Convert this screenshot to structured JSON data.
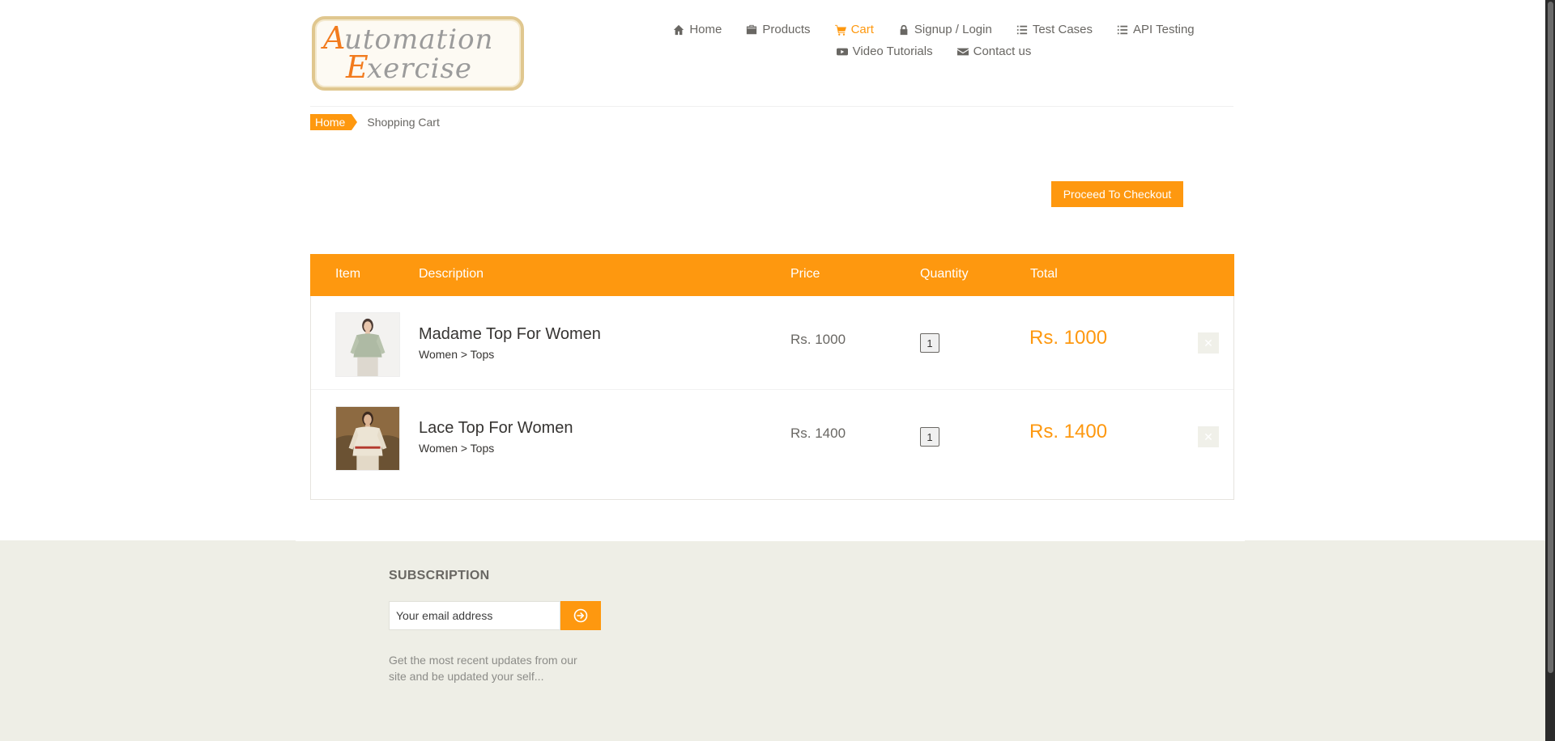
{
  "logo": {
    "line1": "Automation",
    "line2": "Exercise"
  },
  "nav": {
    "items": [
      {
        "label": "Home",
        "icon": "home-icon"
      },
      {
        "label": "Products",
        "icon": "shopping-bag-icon"
      },
      {
        "label": "Cart",
        "icon": "cart-icon"
      },
      {
        "label": "Signup / Login",
        "icon": "lock-icon"
      },
      {
        "label": "Test Cases",
        "icon": "list-icon"
      },
      {
        "label": "API Testing",
        "icon": "list-icon"
      },
      {
        "label": "Video Tutorials",
        "icon": "youtube-play-icon"
      },
      {
        "label": "Contact us",
        "icon": "envelope-icon"
      }
    ],
    "active": "Cart"
  },
  "breadcrumb": {
    "home": "Home",
    "current": "Shopping Cart"
  },
  "checkout": {
    "label": "Proceed To Checkout"
  },
  "cart": {
    "headers": {
      "item": "Item",
      "description": "Description",
      "price": "Price",
      "quantity": "Quantity",
      "total": "Total"
    },
    "rows": [
      {
        "name": "Madame Top For Women",
        "category": "Women > Tops",
        "price": "Rs. 1000",
        "quantity": "1",
        "total": "Rs. 1000",
        "delete": "✕"
      },
      {
        "name": "Lace Top For Women",
        "category": "Women > Tops",
        "price": "Rs. 1400",
        "quantity": "1",
        "total": "Rs. 1400",
        "delete": "✕"
      }
    ]
  },
  "footer": {
    "subscription_title": "SUBSCRIPTION",
    "email_placeholder": "Your email address",
    "subscribe_text": "Get the most recent updates from our site and be updated your self..."
  },
  "colors": {
    "accent": "#FE980F",
    "footer_bg": "#EEEEE6",
    "text": "#696763"
  }
}
